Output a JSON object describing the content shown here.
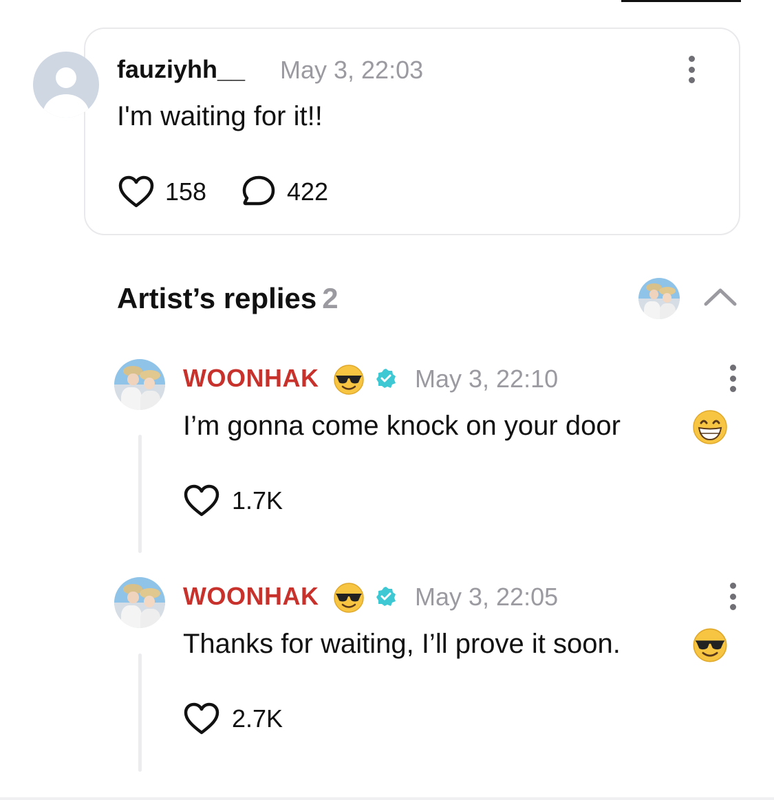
{
  "comment": {
    "author": "fauziyhh__",
    "timestamp": "May 3, 22:03",
    "text": "I'm waiting for it!!",
    "likes": "158",
    "replies": "422"
  },
  "artist_replies": {
    "title": "Artist’s replies",
    "count": "2"
  },
  "replies": [
    {
      "author": "WOONHAK",
      "author_emoji": "sunglasses-face-emoji",
      "verified": true,
      "timestamp": "May 3, 22:10",
      "text": "I’m gonna come knock on your door",
      "text_emoji": "grinning-face-emoji",
      "likes": "1.7K"
    },
    {
      "author": "WOONHAK",
      "author_emoji": "sunglasses-face-emoji",
      "verified": true,
      "timestamp": "May 3, 22:05",
      "text": "Thanks for waiting, I’ll prove it soon.",
      "text_emoji": "sunglasses-face-emoji",
      "likes": "2.7K"
    }
  ],
  "colors": {
    "artist_name": "#c8322d",
    "verified_badge": "#3ec8d4",
    "muted_text": "#9a9aa0",
    "card_border": "#e9e9ec"
  }
}
